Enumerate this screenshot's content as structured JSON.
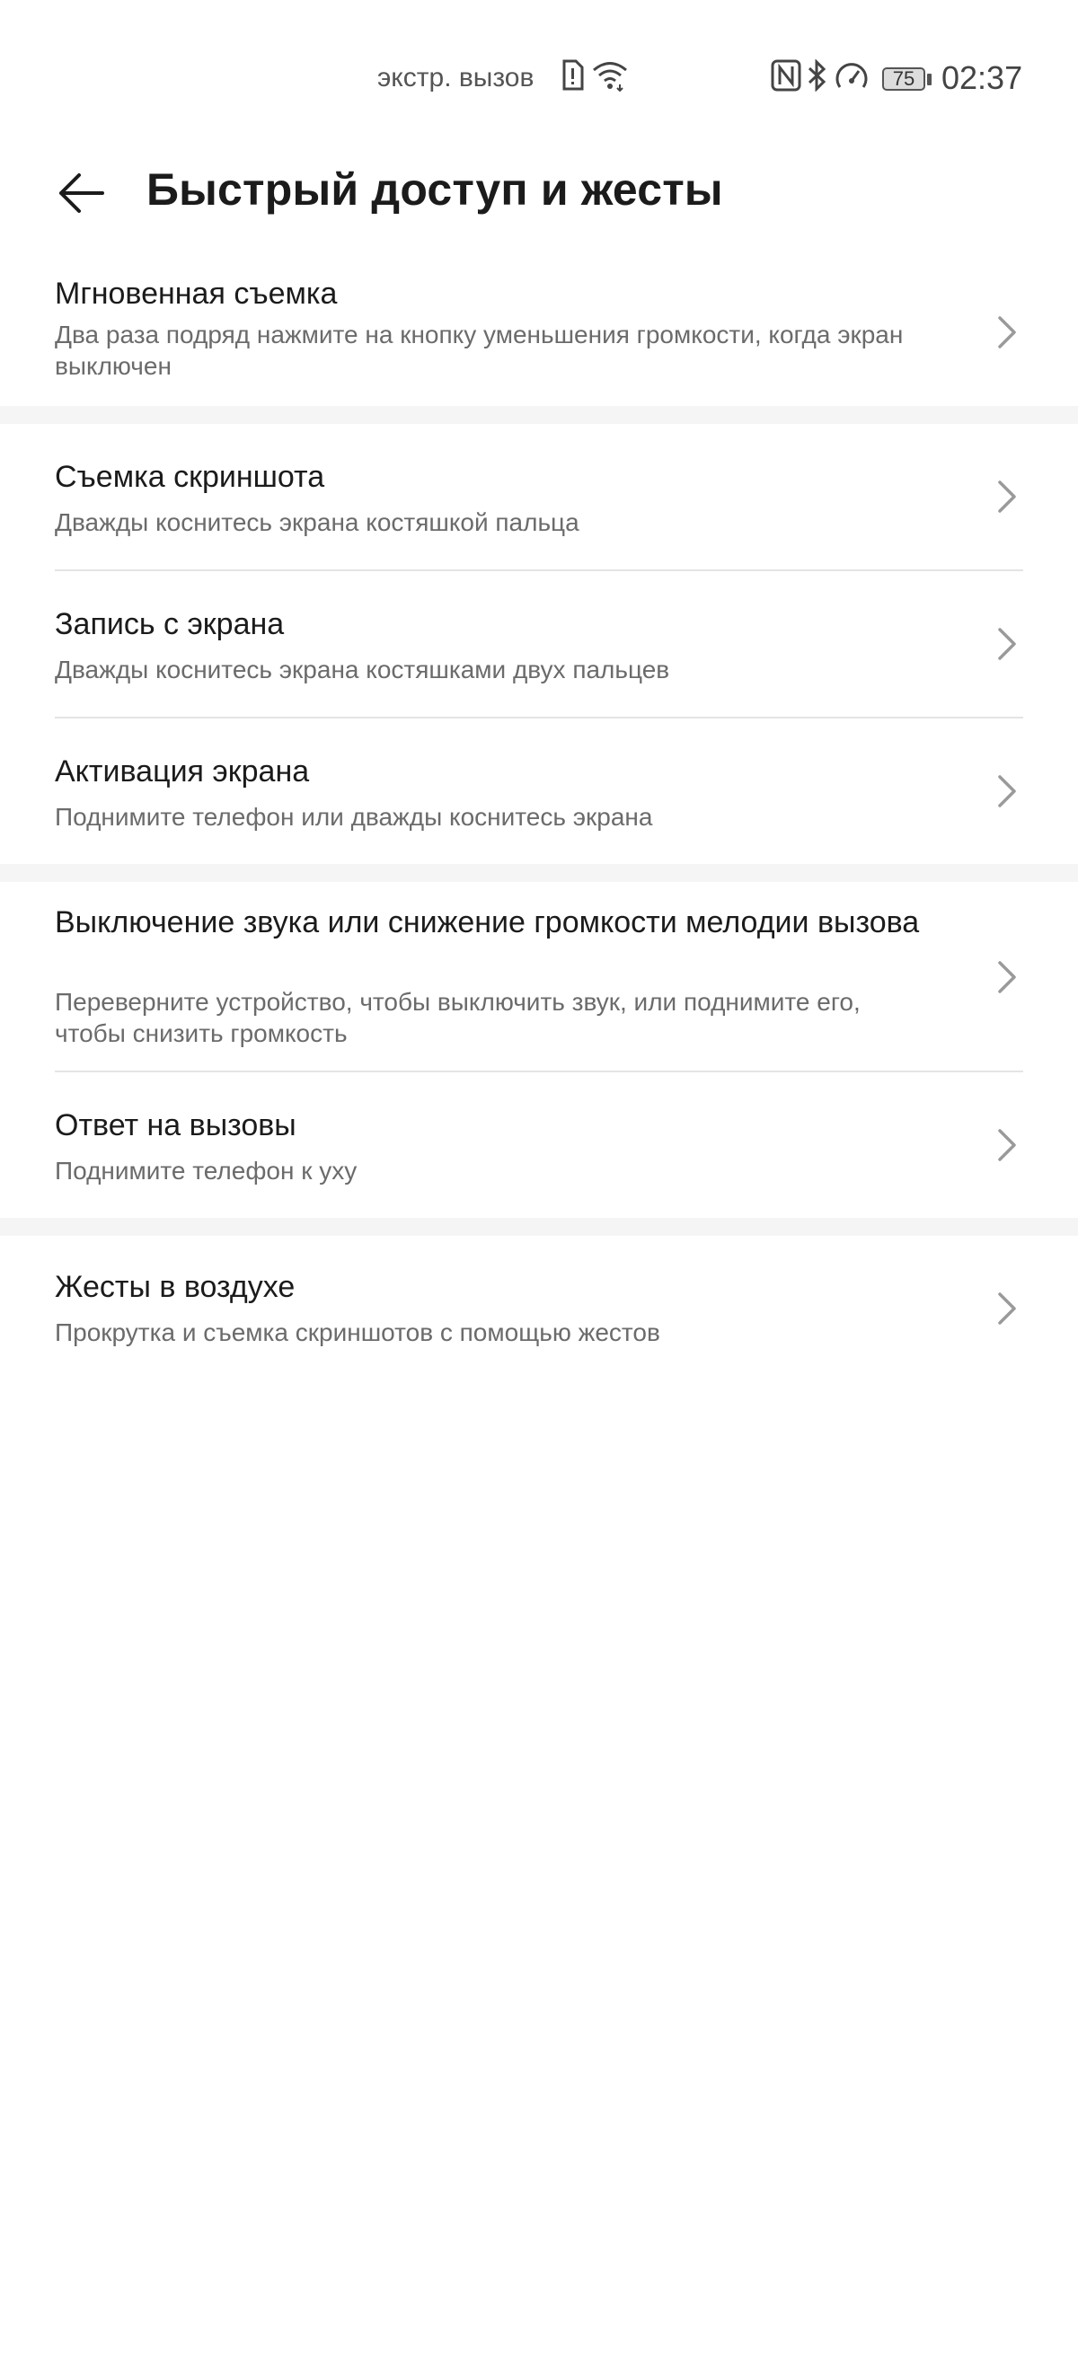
{
  "status_bar": {
    "emergency_text": "экстр. вызов",
    "battery_level": "75",
    "time": "02:37",
    "icons": [
      "sim-alert-icon",
      "wifi-icon",
      "nfc-icon",
      "bluetooth-icon",
      "speedometer-icon",
      "battery-icon"
    ]
  },
  "header": {
    "back_icon": "arrow-left-icon",
    "title": "Быстрый доступ и жесты"
  },
  "items": [
    {
      "title": "Мгновенная съемка",
      "subtitle": "Два раза подряд нажмите на кнопку уменьшения громкости, когда экран выключен"
    },
    {
      "title": "Съемка скриншота",
      "subtitle": "Дважды коснитесь экрана костяшкой пальца"
    },
    {
      "title": "Запись с экрана",
      "subtitle": "Дважды коснитесь экрана костяшками двух пальцев"
    },
    {
      "title": "Активация экрана",
      "subtitle": "Поднимите телефон или дважды коснитесь экрана"
    },
    {
      "title": "Выключение звука или снижение громкости мелодии вызова",
      "subtitle": "Переверните устройство, чтобы выключить звук, или поднимите его, чтобы снизить громкость"
    },
    {
      "title": "Ответ на вызовы",
      "subtitle": "Поднимите телефон к уху"
    },
    {
      "title": "Жесты в воздухе",
      "subtitle": "Прокрутка и съемка скриншотов с помощью жестов"
    }
  ],
  "colors": {
    "background": "#ffffff",
    "section_gap": "#f5f5f5",
    "title_text": "#1b1b1b",
    "subtitle_text": "#6b6b6b",
    "chevron": "#9a9a9a"
  }
}
